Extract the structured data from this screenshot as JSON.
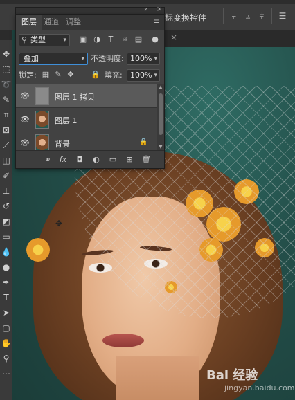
{
  "options_bar": {
    "transform_controls_label": "标变换控件",
    "icons": [
      "align-left-icon",
      "align-center-icon",
      "align-right-icon",
      "distribute-icon"
    ]
  },
  "panel": {
    "tabs": [
      "图层",
      "通道",
      "调整"
    ],
    "active_tab": "图层",
    "filter": {
      "kind_label": "类型",
      "icons": [
        "pixel-filter-icon",
        "adjustment-filter-icon",
        "type-filter-icon",
        "shape-filter-icon",
        "smartobject-filter-icon"
      ]
    },
    "blend_mode": "叠加",
    "opacity": {
      "label": "不透明度:",
      "value": "100%"
    },
    "lock": {
      "label": "锁定:",
      "icons": [
        "lock-transparent-icon",
        "lock-paint-icon",
        "lock-position-icon",
        "lock-artboard-icon",
        "lock-all-icon"
      ]
    },
    "fill": {
      "label": "填充:",
      "value": "100%"
    },
    "layers": [
      {
        "name": "图层 1 拷贝",
        "selected": true,
        "visible": true,
        "thumb": "gray",
        "locked": false
      },
      {
        "name": "图层 1",
        "selected": false,
        "visible": true,
        "thumb": "photo",
        "locked": false
      },
      {
        "name": "背景",
        "selected": false,
        "visible": true,
        "thumb": "photo",
        "locked": true
      }
    ],
    "footer_icons": [
      "link-icon",
      "fx-icon",
      "mask-icon",
      "adjustment-icon",
      "group-icon",
      "new-layer-icon",
      "delete-icon"
    ],
    "footer_fx": "fx"
  },
  "watermark": {
    "text": "Bai 经验",
    "sub": "jingyan.baidu.com"
  },
  "colors": {
    "canvas_bg": "#234e49",
    "panel_bg": "#424242",
    "selected_layer": "#5a5a5a",
    "accent": "#3f8fd8"
  }
}
